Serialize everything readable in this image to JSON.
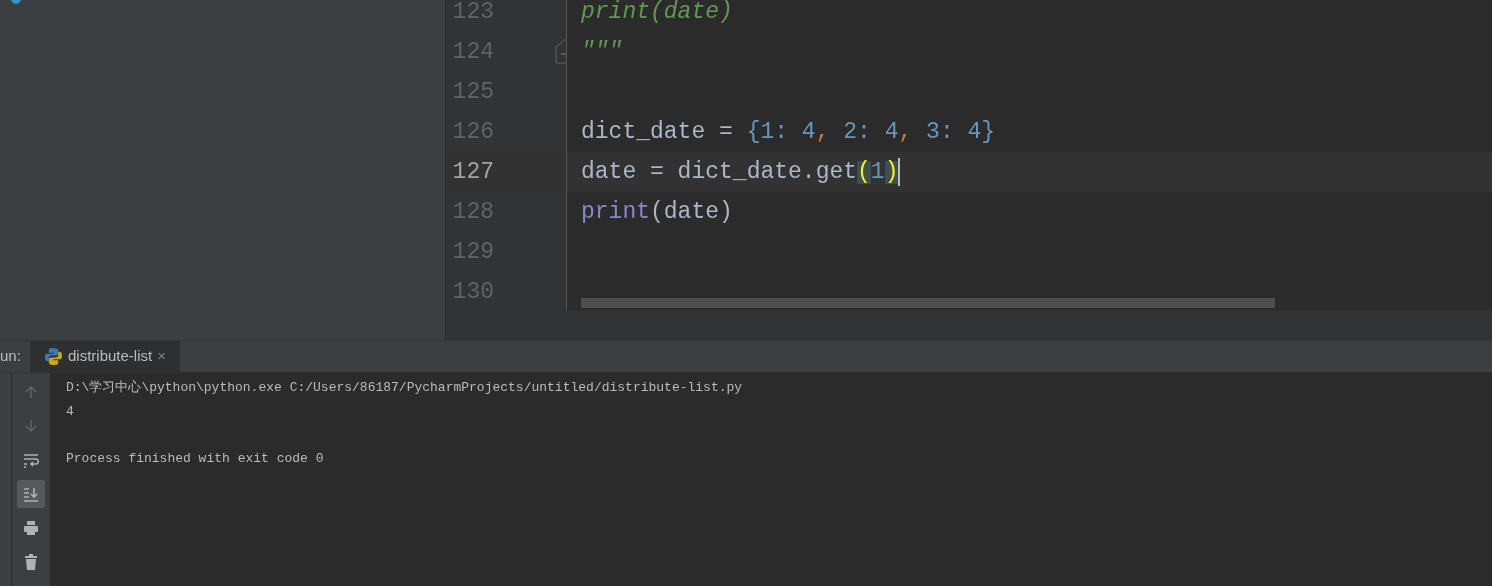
{
  "editor": {
    "lines": [
      {
        "number": "123",
        "current": false,
        "tokens": [
          {
            "kind": "comment",
            "text": "print(date)"
          }
        ]
      },
      {
        "number": "124",
        "current": false,
        "fold": true,
        "tokens": [
          {
            "kind": "comment",
            "text": "\"\"\""
          }
        ]
      },
      {
        "number": "125",
        "current": false
      },
      {
        "number": "126",
        "current": false,
        "tokens": [
          {
            "kind": "plain",
            "text": "dict_date = "
          },
          {
            "kind": "number",
            "text": "{1: 4"
          },
          {
            "kind": "comma",
            "text": ", "
          },
          {
            "kind": "number",
            "text": "2: 4"
          },
          {
            "kind": "comma",
            "text": ", "
          },
          {
            "kind": "number",
            "text": "3: 4}"
          }
        ]
      },
      {
        "number": "127",
        "current": true,
        "tokens": [
          {
            "kind": "plain",
            "text": "date = dict_date.get"
          },
          {
            "kind": "paren",
            "text": "("
          },
          {
            "kind": "number",
            "text": "1"
          },
          {
            "kind": "paren",
            "text": ")"
          }
        ]
      },
      {
        "number": "128",
        "current": false,
        "tokens": [
          {
            "kind": "builtin",
            "text": "print"
          },
          {
            "kind": "plain",
            "text": "(date)"
          }
        ]
      },
      {
        "number": "129",
        "current": false
      },
      {
        "number": "130",
        "current": false
      }
    ]
  },
  "run": {
    "label": "un:",
    "tabs": [
      {
        "label": "distribute-list",
        "selected": true,
        "close": "×"
      }
    ],
    "toolbar": [
      {
        "kind": "up",
        "disabled": true,
        "selected": false
      },
      {
        "kind": "down",
        "disabled": true,
        "selected": false
      },
      {
        "kind": "wrap",
        "disabled": false,
        "selected": false
      },
      {
        "kind": "scroll-end",
        "disabled": false,
        "selected": true
      },
      {
        "kind": "print",
        "disabled": false,
        "selected": false
      },
      {
        "kind": "trash",
        "disabled": false,
        "selected": false
      }
    ],
    "console": {
      "output": [
        "D:\\学习中心\\python\\python.exe C:/Users/86187/PycharmProjects/untitled/distribute-list.py",
        "4"
      ],
      "exit_message": "Process finished with exit code 0"
    }
  }
}
